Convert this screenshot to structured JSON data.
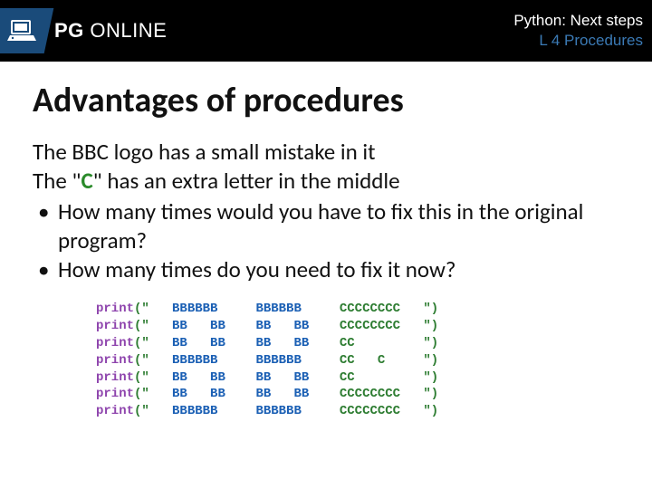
{
  "header": {
    "brand_pg": "PG",
    "brand_online": " ONLINE",
    "line1": "Python: Next steps",
    "line2": "L 4 Procedures"
  },
  "title": "Advantages of procedures",
  "body": {
    "line1": "The BBC logo has a small mistake in it",
    "line2a": "The \"",
    "line2b": "C",
    "line2c": "\" has an extra letter in the middle",
    "bullet1": "How many times would you have to fix this in the original program?",
    "bullet2": "How many times do you need to fix it now?"
  },
  "code": {
    "rows": [
      {
        "b1": "BBBBBB ",
        "b2": "BBBBBB ",
        "c": "CCCCCCCC"
      },
      {
        "b1": "BB   BB",
        "b2": "BB   BB",
        "c": "CCCCCCCC"
      },
      {
        "b1": "BB   BB",
        "b2": "BB   BB",
        "c": "CC      "
      },
      {
        "b1": "BBBBBB ",
        "b2": "BBBBBB ",
        "c": "CC   C  "
      },
      {
        "b1": "BB   BB",
        "b2": "BB   BB",
        "c": "CC      "
      },
      {
        "b1": "BB   BB",
        "b2": "BB   BB",
        "c": "CCCCCCCC"
      },
      {
        "b1": "BBBBBB ",
        "b2": "BBBBBB ",
        "c": "CCCCCCCC"
      }
    ]
  }
}
